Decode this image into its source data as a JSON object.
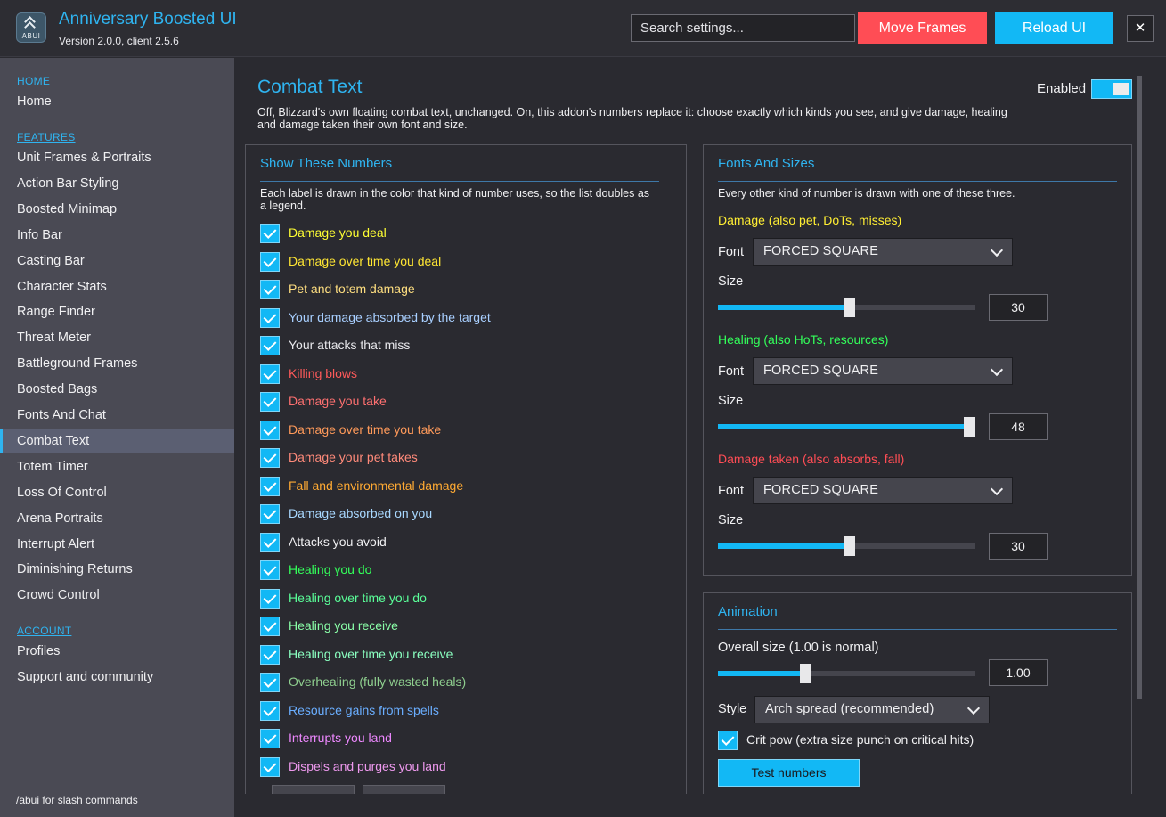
{
  "app": {
    "logo_text": "ABUI",
    "title": "Anniversary Boosted UI",
    "version": "Version 2.0.0, client 2.5.6"
  },
  "header": {
    "search_placeholder": "Search settings...",
    "move_frames": "Move Frames",
    "reload_ui": "Reload UI",
    "close": "✕",
    "colors": {
      "move": "#ff4d55",
      "reload": "#12b8f5"
    }
  },
  "sidebar": {
    "sections": {
      "home": "HOME",
      "features": "FEATURES",
      "account": "ACCOUNT"
    },
    "home_items": [
      "Home"
    ],
    "feature_items": [
      "Unit Frames & Portraits",
      "Action Bar Styling",
      "Boosted Minimap",
      "Info Bar",
      "Casting Bar",
      "Character Stats",
      "Range Finder",
      "Threat Meter",
      "Battleground Frames",
      "Boosted Bags",
      "Fonts And Chat",
      "Combat Text",
      "Totem Timer",
      "Loss Of Control",
      "Arena Portraits",
      "Interrupt Alert",
      "Diminishing Returns",
      "Crowd Control"
    ],
    "active_item": "Combat Text",
    "account_items": [
      "Profiles",
      "Support and community"
    ],
    "footer": "/abui for slash commands"
  },
  "page": {
    "title": "Combat Text",
    "description": "Off, Blizzard's own floating combat text, unchanged.  On, this addon's numbers replace it: choose exactly which kinds you see, and give damage, healing and damage taken their own font and size.",
    "enabled_label": "Enabled",
    "enabled": true
  },
  "show_numbers": {
    "title": "Show These Numbers",
    "subtitle": "Each label is drawn in the color that kind of number uses, so the list doubles as a legend.",
    "items": [
      {
        "label": "Damage you deal",
        "color": "#ffff33",
        "checked": true
      },
      {
        "label": "Damage over time you deal",
        "color": "#ffe633",
        "checked": true
      },
      {
        "label": "Pet and totem damage",
        "color": "#ffdf80",
        "checked": true
      },
      {
        "label": "Your damage absorbed by the target",
        "color": "#a8cfff",
        "checked": true
      },
      {
        "label": "Your attacks that miss",
        "color": "#e8e8ec",
        "checked": true
      },
      {
        "label": "Killing blows",
        "color": "#ff5a5a",
        "checked": true
      },
      {
        "label": "Damage you take",
        "color": "#ff7070",
        "checked": true
      },
      {
        "label": "Damage over time you take",
        "color": "#ff9a5a",
        "checked": true
      },
      {
        "label": "Damage your pet takes",
        "color": "#ff8a7a",
        "checked": true
      },
      {
        "label": "Fall and environmental damage",
        "color": "#ffaa33",
        "checked": true
      },
      {
        "label": "Damage absorbed on you",
        "color": "#a8d8ff",
        "checked": true
      },
      {
        "label": "Attacks you avoid",
        "color": "#f0f0f2",
        "checked": true
      },
      {
        "label": "Healing you do",
        "color": "#33ff5a",
        "checked": true
      },
      {
        "label": "Healing over time you do",
        "color": "#5aff99",
        "checked": true
      },
      {
        "label": "Healing you receive",
        "color": "#8affa8",
        "checked": true
      },
      {
        "label": "Healing over time you receive",
        "color": "#8affc0",
        "checked": true
      },
      {
        "label": "Overhealing (fully wasted heals)",
        "color": "#8fcf8f",
        "checked": true
      },
      {
        "label": "Resource gains from spells",
        "color": "#6aaeff",
        "checked": true
      },
      {
        "label": "Interrupts you land",
        "color": "#ee88ff",
        "checked": true
      },
      {
        "label": "Dispels and purges you land",
        "color": "#ee99ee",
        "checked": true
      }
    ]
  },
  "fonts": {
    "title": "Fonts And Sizes",
    "subtitle": "Every other kind of number is drawn with one of these three.",
    "font_label": "Font",
    "size_label": "Size",
    "groups": [
      {
        "heading": "Damage (also pet, DoTs, misses)",
        "color": "#ffee33",
        "font": "FORCED SQUARE",
        "size": "30",
        "size_fraction": 0.52
      },
      {
        "heading": "Healing (also HoTs, resources)",
        "color": "#33ff5a",
        "font": "FORCED SQUARE",
        "size": "48",
        "size_fraction": 1.0
      },
      {
        "heading": "Damage taken (also absorbs, fall)",
        "color": "#ff4d55",
        "font": "FORCED SQUARE",
        "size": "30",
        "size_fraction": 0.52
      }
    ]
  },
  "animation": {
    "title": "Animation",
    "overall_label": "Overall size (1.00 is normal)",
    "overall_value": "1.00",
    "overall_fraction": 0.34,
    "style_label": "Style",
    "style_value": "Arch spread (recommended)",
    "crit_label": "Crit pow (extra size punch on critical hits)",
    "crit_checked": true,
    "test_button": "Test numbers"
  }
}
